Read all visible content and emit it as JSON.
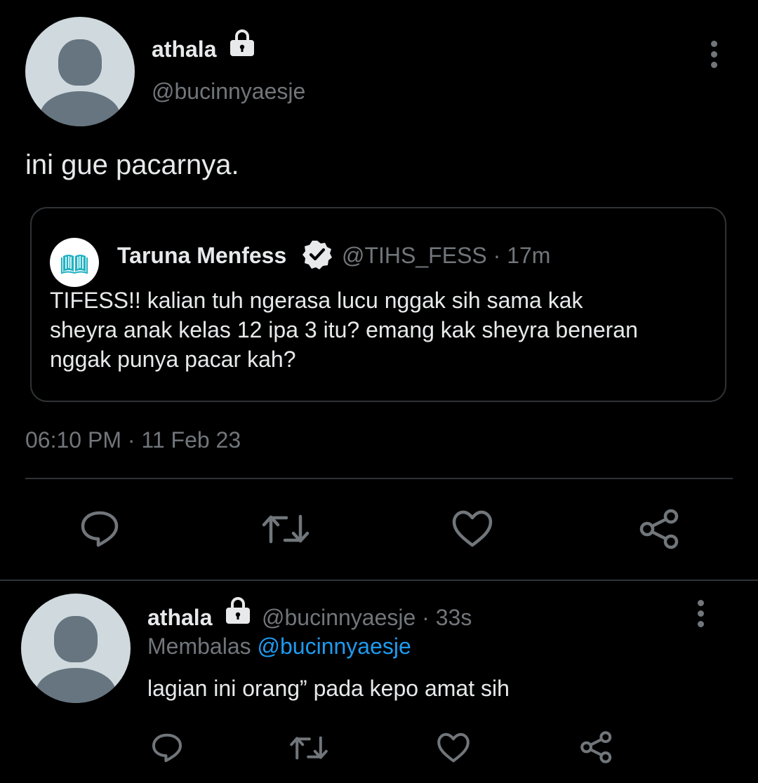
{
  "main_tweet": {
    "display_name": "athala",
    "handle": "@bucinnyaesje",
    "text": "ini gue pacarnya.",
    "timestamp": "06:10 PM · 11 Feb 23",
    "locked_icon": "lock-icon",
    "more_icon": "more-vertical-icon"
  },
  "quoted_tweet": {
    "display_name": "Taruna Menfess",
    "verified_icon": "verified-badge-icon",
    "handle_time": "@TIHS_FESS · 17m",
    "text_lines": [
      "TIFESS!! kalian tuh ngerasa lucu nggak sih sama kak",
      "sheyra anak kelas 12 ipa 3 itu? emang kak sheyra beneran",
      "nggak punya pacar kah?"
    ],
    "avatar_icon": "book-icon"
  },
  "actions": {
    "reply_icon": "reply-icon",
    "retweet_icon": "retweet-icon",
    "like_icon": "like-icon",
    "share_icon": "share-icon"
  },
  "reply_tweet": {
    "display_name": "athala",
    "handle_time": "@bucinnyaesje · 33s",
    "replying_prefix": "Membalas",
    "replying_to": "@bucinnyaesje",
    "text": "lagian ini orang” pada kepo amat sih"
  },
  "colors": {
    "background": "#000000",
    "text": "#e7e9ea",
    "muted": "#71767b",
    "link": "#1d9bf0",
    "border": "#2f3336",
    "avatar_bg": "#cfd9de",
    "avatar_fg": "#66757f",
    "book_teal": "#20b2c2"
  }
}
